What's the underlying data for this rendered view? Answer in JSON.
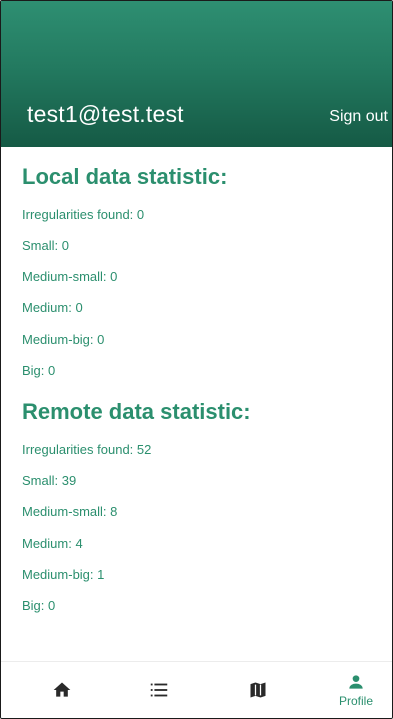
{
  "header": {
    "user_email": "test1@test.test",
    "sign_out_label": "Sign out",
    "gradient_top": "#2e8f72",
    "gradient_bottom": "#155a45"
  },
  "local": {
    "title": "Local data statistic:",
    "irregularities": "Irregularities found: 0",
    "small": "Small: 0",
    "medium_small": "Medium-small: 0",
    "medium": "Medium: 0",
    "medium_big": "Medium-big: 0",
    "big": "Big: 0"
  },
  "remote": {
    "title": "Remote data statistic:",
    "irregularities": "Irregularities found: 52",
    "small": "Small: 39",
    "medium_small": "Medium-small: 8",
    "medium": "Medium: 4",
    "medium_big": "Medium-big: 1",
    "big": "Big: 0"
  },
  "bottom_nav": {
    "items": [
      {
        "icon": "home-icon"
      },
      {
        "icon": "list-icon"
      },
      {
        "icon": "map-icon"
      },
      {
        "icon": "person-icon",
        "label": "Profile",
        "active": true
      }
    ]
  },
  "colors": {
    "accent": "#2b8f6e",
    "icon_inactive": "#2a2a2a"
  }
}
